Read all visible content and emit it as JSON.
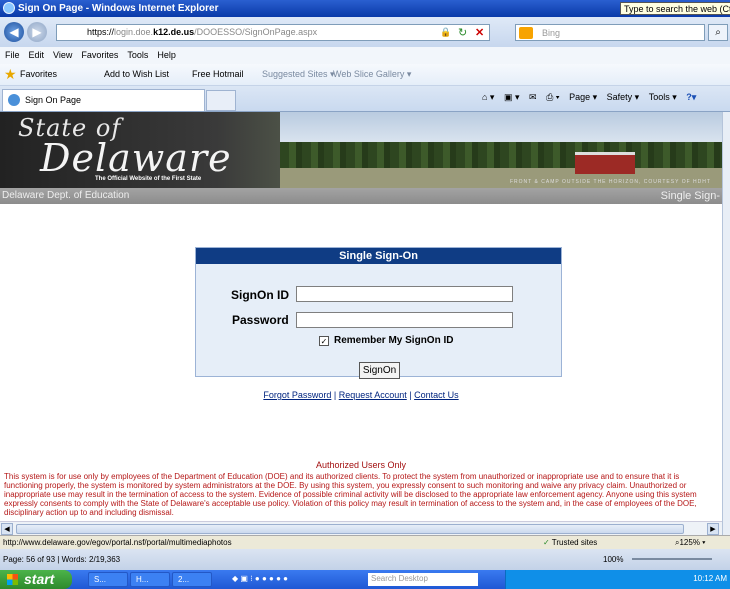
{
  "window": {
    "title": "Sign On Page - Windows Internet Explorer",
    "search_hint": "Type to search the web (Ctrl+"
  },
  "address": {
    "prefix": "https://",
    "domain_dim": "login.doe.",
    "domain_bold": "k12.de.us",
    "path": "/DOOESSO/SignOnPage.aspx"
  },
  "search": {
    "placeholder": "Bing"
  },
  "menu": [
    "File",
    "Edit",
    "View",
    "Favorites",
    "Tools",
    "Help"
  ],
  "favorites": {
    "label": "Favorites",
    "items": [
      "Add to Wish List",
      "Free Hotmail",
      "Suggested Sites ▾",
      "Web Slice Gallery ▾"
    ]
  },
  "tab": {
    "title": "Sign On Page"
  },
  "commands": [
    "Page ▾",
    "Safety ▾",
    "Tools ▾"
  ],
  "banner": {
    "state_of": "State of",
    "delaware": "Delaware",
    "tagline": "The Official Website of the First State",
    "strip": "FRONT & CAMP OUTSIDE THE HORIZON, COURTESY OF HDHT"
  },
  "dept": {
    "left": "Delaware Dept. of Education",
    "right": "Single Sign-"
  },
  "login": {
    "header": "Single Sign-On",
    "id_label": "SignOn ID",
    "id_value": "",
    "password_label": "Password",
    "password_value": "",
    "remember_label": "Remember My SignOn ID",
    "remember_checked": "✓",
    "button": "SignOn"
  },
  "links": {
    "forgot": "Forgot Password",
    "request": "Request Account",
    "contact": "Contact Us"
  },
  "authorized": "Authorized Users Only",
  "disclaimer": "This system is for use only by employees of the Department of Education (DOE) and its authorized clients. To protect the system from unauthorized or inappropriate use and to ensure that it is functioning properly, the system is monitored by system administrators at the DOE. By using this system, you expressly consent to such monitoring and waive any privacy claim. Unauthorized or inappropriate use may result in the termination of access to the system. Evidence of possible criminal activity will be disclosed to the appropriate law enforcement agency. Anyone using this system expressly consents to comply with the State of Delaware's acceptable use policy. Violation of this policy may result in termination of access to the system and, in the case of employees of the DOE, disciplinary action up to and including dismissal.",
  "status": {
    "url": "http://www.delaware.gov/egov/portal.nsf/portal/multimediaphotos",
    "zone": "Trusted sites",
    "zoom": "125%"
  },
  "word": {
    "page": "Page: 56 of 93",
    "words": "Words: 2/19,363",
    "zoom": "100%"
  },
  "taskbar": {
    "start": "start",
    "buttons": [
      "S...",
      "H...",
      "2..."
    ],
    "desktop_search": "Search Desktop",
    "clock": "10:12 AM"
  }
}
